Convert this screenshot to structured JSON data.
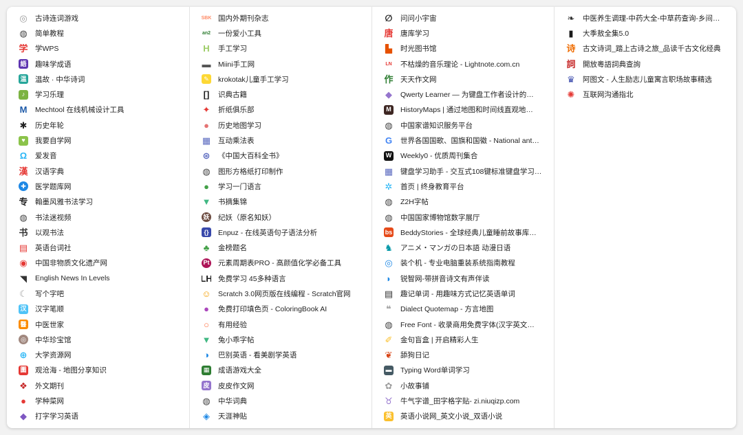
{
  "columns": [
    [
      {
        "label": "古诗连词游戏",
        "icon": "poem-game-icon",
        "color": "#c9c9c9",
        "glyph": "◎",
        "style": "glyph",
        "fg": "#9a9a9a"
      },
      {
        "label": "简单教程",
        "icon": "globe-icon",
        "color": "#444444",
        "glyph": "◍",
        "style": "glyph",
        "fg": "#444444"
      },
      {
        "label": "学WPS",
        "icon": "xue-icon",
        "color": "#e53935",
        "glyph": "学",
        "style": "glyph",
        "fg": "#e53935"
      },
      {
        "label": "趣味学成语",
        "icon": "idiom-icon",
        "color": "#5e35b1",
        "glyph": "語",
        "style": "box"
      },
      {
        "label": "温故 · 中华诗词",
        "icon": "poetry-icon",
        "color": "#26a69a",
        "glyph": "温",
        "style": "box"
      },
      {
        "label": "学习乐理",
        "icon": "music-note-icon",
        "color": "#7cb342",
        "glyph": "♪",
        "style": "box"
      },
      {
        "label": "Mechtool 在线机械设计工具",
        "icon": "mechtool-icon",
        "color": "#1e5aa8",
        "glyph": "M",
        "style": "glyph",
        "fg": "#1e5aa8"
      },
      {
        "label": "历史年轮",
        "icon": "history-wheel-icon",
        "color": "#222222",
        "glyph": "✱",
        "style": "glyph",
        "fg": "#222222"
      },
      {
        "label": "我要自学网",
        "icon": "self-study-icon",
        "color": "#8bc34a",
        "glyph": "♥",
        "style": "box"
      },
      {
        "label": "爱发音",
        "icon": "pronounce-icon",
        "color": "#29b6f6",
        "glyph": "Ω",
        "style": "glyph",
        "fg": "#29b6f6"
      },
      {
        "label": "汉语字典",
        "icon": "dictionary-icon",
        "color": "#e53935",
        "glyph": "漢",
        "style": "glyph",
        "fg": "#e53935"
      },
      {
        "label": "医学题库网",
        "icon": "medical-icon",
        "color": "#1e88e5",
        "glyph": "✚",
        "style": "box",
        "round": true
      },
      {
        "label": "翰墨风雅书法学习",
        "icon": "calligraphy-icon",
        "color": "#222222",
        "glyph": "专",
        "style": "glyph",
        "fg": "#222222"
      },
      {
        "label": "书法迷视频",
        "icon": "globe-icon",
        "color": "#444444",
        "glyph": "◍",
        "style": "glyph",
        "fg": "#444444"
      },
      {
        "label": "以观书法",
        "icon": "yiguan-icon",
        "color": "#333333",
        "glyph": "书",
        "style": "glyph",
        "fg": "#333333"
      },
      {
        "label": "英语台词社",
        "icon": "document-icon",
        "color": "#e53935",
        "glyph": "▤",
        "style": "glyph",
        "fg": "#e53935"
      },
      {
        "label": "中国非物质文化遗产网",
        "icon": "heritage-icon",
        "color": "#e53935",
        "glyph": "◉",
        "style": "glyph",
        "fg": "#e53935"
      },
      {
        "label": "English News In Levels",
        "icon": "news-icon",
        "color": "#333333",
        "glyph": "◥",
        "style": "glyph",
        "fg": "#333333"
      },
      {
        "label": "写个字吧",
        "icon": "write-icon",
        "color": "#9e9e9e",
        "glyph": "☾",
        "style": "glyph",
        "fg": "#9e9e9e"
      },
      {
        "label": "汉字笔顺",
        "icon": "stroke-order-icon",
        "color": "#4fc3f7",
        "glyph": "汉",
        "style": "box"
      },
      {
        "label": "中医世家",
        "icon": "tcm-icon",
        "color": "#fb8c00",
        "glyph": "醫",
        "style": "box"
      },
      {
        "label": "中华珍宝馆",
        "icon": "treasure-icon",
        "color": "#a1887f",
        "glyph": "◎",
        "style": "box",
        "round": true
      },
      {
        "label": "大学资源网",
        "icon": "university-icon",
        "color": "#29b6f6",
        "glyph": "⊕",
        "style": "glyph",
        "fg": "#29b6f6"
      },
      {
        "label": "观沧海 - 地图分享知识",
        "icon": "map-icon",
        "color": "#e53935",
        "glyph": "圖",
        "style": "box"
      },
      {
        "label": "外文期刊",
        "icon": "journal-icon",
        "color": "#c62828",
        "glyph": "❖",
        "style": "glyph",
        "fg": "#c62828"
      },
      {
        "label": "学种菜网",
        "icon": "vegetable-icon",
        "color": "#e53935",
        "glyph": "●",
        "style": "glyph",
        "fg": "#e53935"
      },
      {
        "label": "打字学习英语",
        "icon": "typing-icon",
        "color": "#7e57c2",
        "glyph": "◆",
        "style": "glyph",
        "fg": "#7e57c2"
      }
    ],
    [
      {
        "label": "国内外期刊杂志",
        "icon": "periodical-icon",
        "color": "#ff8a65",
        "glyph": "SBK",
        "style": "glyph",
        "fg": "#ff8a65",
        "small": true
      },
      {
        "label": "一份爱小工具",
        "icon": "tool-icon",
        "color": "#2e7d32",
        "glyph": "an2",
        "style": "glyph",
        "fg": "#2e7d32",
        "small": true
      },
      {
        "label": "手工学习",
        "icon": "handcraft-icon",
        "color": "#9ccc65",
        "glyph": "H",
        "style": "glyph",
        "fg": "#9ccc65"
      },
      {
        "label": "Miini手工网",
        "icon": "miini-icon",
        "color": "#555555",
        "glyph": "▬",
        "style": "glyph",
        "fg": "#555555"
      },
      {
        "label": "krokotak儿童手工学习",
        "icon": "crayon-icon",
        "color": "#fdd835",
        "glyph": "✎",
        "style": "box"
      },
      {
        "label": "识典古籍",
        "icon": "ancient-books-icon",
        "color": "#222222",
        "glyph": "[]",
        "style": "glyph",
        "fg": "#222222"
      },
      {
        "label": "折纸俱乐部",
        "icon": "origami-icon",
        "color": "#f9a825",
        "glyph": "✦",
        "style": "glyph",
        "fg": "#e53935"
      },
      {
        "label": "历史地图学习",
        "icon": "history-map-icon",
        "color": "#e53935",
        "glyph": "●",
        "style": "glyph",
        "fg": "#e57373"
      },
      {
        "label": "互动乘法表",
        "icon": "multiplication-icon",
        "color": "#5c6bc0",
        "glyph": "▦",
        "style": "glyph",
        "fg": "#5c6bc0"
      },
      {
        "label": "《中国大百科全书》",
        "icon": "encyclopedia-icon",
        "color": "#5c6bc0",
        "glyph": "⊛",
        "style": "glyph",
        "fg": "#5c6bc0"
      },
      {
        "label": "图形方格纸打印制作",
        "icon": "globe-icon",
        "color": "#444444",
        "glyph": "◍",
        "style": "glyph",
        "fg": "#444444"
      },
      {
        "label": "学习一门语言",
        "icon": "earth-icon",
        "color": "#43a047",
        "glyph": "●",
        "style": "glyph",
        "fg": "#43a047"
      },
      {
        "label": "书摘集锦",
        "icon": "vue-icon",
        "color": "#41b883",
        "glyph": "▼",
        "style": "glyph",
        "fg": "#41b883"
      },
      {
        "label": "纪妖（原名知妖）",
        "icon": "yao-icon",
        "color": "#6d4c41",
        "glyph": "妖",
        "style": "box",
        "round": true
      },
      {
        "label": "Enpuz - 在线英语句子语法分析",
        "icon": "enpuz-icon",
        "color": "#3949ab",
        "glyph": "{}",
        "style": "box"
      },
      {
        "label": "金榜题名",
        "icon": "tree-icon",
        "color": "#43a047",
        "glyph": "♣",
        "style": "glyph",
        "fg": "#43a047"
      },
      {
        "label": "元素周期表PRO - 高颜值化学必备工具",
        "icon": "periodic-table-icon",
        "color": "#ad1457",
        "glyph": "Pt",
        "style": "box",
        "round": true
      },
      {
        "label": "免费学习 45多种语言",
        "icon": "lh-icon",
        "color": "#1a1a1a",
        "glyph": "LH",
        "style": "glyph",
        "fg": "#1a1a1a"
      },
      {
        "label": "Scratch 3.0网页版在线编程 - Scratch官网",
        "icon": "scratch-cat-icon",
        "color": "#ffb74d",
        "glyph": "☺",
        "style": "glyph",
        "fg": "#f59f00"
      },
      {
        "label": "免费打印填色页 - ColoringBook AI",
        "icon": "coloring-icon",
        "color": "#ab47bc",
        "glyph": "●",
        "style": "glyph",
        "fg": "#ab47bc"
      },
      {
        "label": "有用经验",
        "icon": "experience-icon",
        "color": "#ff7043",
        "glyph": "○",
        "style": "glyph",
        "fg": "#ff7043"
      },
      {
        "label": "兔小乖字帖",
        "icon": "vue-icon",
        "color": "#41b883",
        "glyph": "▼",
        "style": "glyph",
        "fg": "#41b883"
      },
      {
        "label": "巴别英语 - 看美剧学英语",
        "icon": "babel-icon",
        "color": "#1e88e5",
        "glyph": "◑",
        "style": "glyph",
        "fg": "#1e88e5"
      },
      {
        "label": "成语游戏大全",
        "icon": "idiom-game-icon",
        "color": "#2e7d32",
        "glyph": "▦",
        "style": "box"
      },
      {
        "label": "皮皮作文网",
        "icon": "essay-icon",
        "color": "#9575cd",
        "glyph": "皮",
        "style": "box"
      },
      {
        "label": "中华词典",
        "icon": "globe-icon",
        "color": "#444444",
        "glyph": "◍",
        "style": "glyph",
        "fg": "#444444"
      },
      {
        "label": "天涯神贴",
        "icon": "tianya-icon",
        "color": "#1e88e5",
        "glyph": "◈",
        "style": "glyph",
        "fg": "#1e88e5"
      }
    ],
    [
      {
        "label": "问问小宇宙",
        "icon": "universe-icon",
        "color": "#222222",
        "glyph": "∅",
        "style": "glyph",
        "fg": "#222222"
      },
      {
        "label": "唐库学习",
        "icon": "tang-icon",
        "color": "#e53935",
        "glyph": "唐",
        "style": "glyph",
        "fg": "#e53935"
      },
      {
        "label": "时光图书馆",
        "icon": "library-icon",
        "color": "#5c6bc0",
        "glyph": "▙",
        "style": "glyph",
        "fg": "#e65100"
      },
      {
        "label": "不枯燥的音乐理论 - Lightnote.com.cn",
        "icon": "lightnote-icon",
        "color": "#e53935",
        "glyph": "LN",
        "style": "glyph",
        "fg": "#e53935",
        "small": true
      },
      {
        "label": "天天作文网",
        "icon": "composition-icon",
        "color": "#2e7d32",
        "glyph": "作",
        "style": "glyph",
        "fg": "#2e7d32"
      },
      {
        "label": "Qwerty Learner — 为键盘工作者设计的…",
        "icon": "qwerty-icon",
        "color": "#7e57c2",
        "glyph": "◆",
        "style": "glyph",
        "fg": "#9575cd"
      },
      {
        "label": "HistoryMaps | 通过地图和时间线直观地…",
        "icon": "historymaps-icon",
        "color": "#3e2723",
        "glyph": "M",
        "style": "box"
      },
      {
        "label": "中国家谱知识服务平台",
        "icon": "globe-icon",
        "color": "#444444",
        "glyph": "◍",
        "style": "glyph",
        "fg": "#444444"
      },
      {
        "label": "世界各国国歌、国旗和国徽 - National ant…",
        "icon": "google-icon",
        "color": "#4285f4",
        "glyph": "G",
        "style": "glyph",
        "fg": "#4285f4"
      },
      {
        "label": "Weekly0 - 优质周刊集合",
        "icon": "weekly-icon",
        "color": "#111111",
        "glyph": "W",
        "style": "box"
      },
      {
        "label": "键盘学习助手 - 交互式108键标准键盘学习…",
        "icon": "keyboard-icon",
        "color": "#5c6bc0",
        "glyph": "▦",
        "style": "glyph",
        "fg": "#5c6bc0"
      },
      {
        "label": "首页 | 终身教育平台",
        "icon": "lifelong-icon",
        "color": "#29b6f6",
        "glyph": "✲",
        "style": "glyph",
        "fg": "#29b6f6"
      },
      {
        "label": "Z2H字帖",
        "icon": "globe-icon",
        "color": "#444444",
        "glyph": "◍",
        "style": "glyph",
        "fg": "#444444"
      },
      {
        "label": "中国国家博物馆数字展厅",
        "icon": "globe-icon",
        "color": "#444444",
        "glyph": "◍",
        "style": "glyph",
        "fg": "#444444"
      },
      {
        "label": "BeddyStories - 全球经典儿童睡前故事库…",
        "icon": "bs-icon",
        "color": "#e64a19",
        "glyph": "bs",
        "style": "box"
      },
      {
        "label": "アニメ・マンガの日本語 动漫日语",
        "icon": "anime-icon",
        "color": "#0097a7",
        "glyph": "♞",
        "style": "glyph",
        "fg": "#0097a7"
      },
      {
        "label": "装个机 - 专业电脑重装系统指南教程",
        "icon": "install-icon",
        "color": "#1e88e5",
        "glyph": "◎",
        "style": "glyph",
        "fg": "#1e88e5"
      },
      {
        "label": "锐智网-带拼音诗文有声伴读",
        "icon": "ruizhi-icon",
        "color": "#fdd835",
        "glyph": "◗",
        "style": "glyph",
        "fg": "#1e88e5"
      },
      {
        "label": "趣记单词 - 用趣味方式记忆英语单词",
        "icon": "word-icon",
        "color": "#333333",
        "glyph": "▤",
        "style": "glyph",
        "fg": "#333333"
      },
      {
        "label": "Dialect Quotemap - 方言地图",
        "icon": "dialect-icon",
        "color": "#9e9e9e",
        "glyph": "❝",
        "style": "glyph",
        "fg": "#9e9e9e"
      },
      {
        "label": "Free Font - 收录商用免费字体(汉字英文…",
        "icon": "globe-icon",
        "color": "#444444",
        "glyph": "◍",
        "style": "glyph",
        "fg": "#444444"
      },
      {
        "label": "金句盲盒 | 开启精彩人生",
        "icon": "quote-box-icon",
        "color": "#fbc02d",
        "glyph": "✐",
        "style": "glyph",
        "fg": "#fbc02d"
      },
      {
        "label": "舔狗日记",
        "icon": "dog-icon",
        "color": "#d84315",
        "glyph": "❦",
        "style": "glyph",
        "fg": "#d84315"
      },
      {
        "label": "Typing Word单词学习",
        "icon": "typing-word-icon",
        "color": "#455a64",
        "glyph": "▬",
        "style": "box"
      },
      {
        "label": "小故事铺",
        "icon": "story-icon",
        "color": "#9e9e9e",
        "glyph": "✿",
        "style": "glyph",
        "fg": "#9e9e9e"
      },
      {
        "label": "牛气字谱_田字格字贴- zi.niuqizp.com",
        "icon": "niuqi-icon",
        "color": "#9575cd",
        "glyph": "♉",
        "style": "glyph",
        "fg": "#9575cd"
      },
      {
        "label": "英语小说网_英文小说_双语小说",
        "icon": "novel-icon",
        "color": "#fbc02d",
        "glyph": "英",
        "style": "box"
      }
    ],
    [
      {
        "label": "中医养生调理-中药大全-中草药查询-乡间…",
        "icon": "herb-icon",
        "color": "#333333",
        "glyph": "❧",
        "style": "glyph",
        "fg": "#333333"
      },
      {
        "label": "大季敖全集5.0",
        "icon": "book-icon",
        "color": "#1a1a1a",
        "glyph": "▮",
        "style": "glyph",
        "fg": "#1a1a1a"
      },
      {
        "label": "古文诗词_踏上古诗之旅_品读千古文化经典",
        "icon": "classical-poem-icon",
        "color": "#ef6c00",
        "glyph": "诗",
        "style": "glyph",
        "fg": "#ef6c00"
      },
      {
        "label": "開放粵語詞典查詢",
        "icon": "cantonese-icon",
        "color": "#c62828",
        "glyph": "詞",
        "style": "glyph",
        "fg": "#c62828"
      },
      {
        "label": "阿图文 - 人生励志儿童寓言职场故事精选",
        "icon": "atuwen-icon",
        "color": "#3949ab",
        "glyph": "♛",
        "style": "glyph",
        "fg": "#3949ab"
      },
      {
        "label": "互联网沟通指北",
        "icon": "compass-icon",
        "color": "#e53935",
        "glyph": "✺",
        "style": "glyph",
        "fg": "#e53935"
      }
    ]
  ]
}
